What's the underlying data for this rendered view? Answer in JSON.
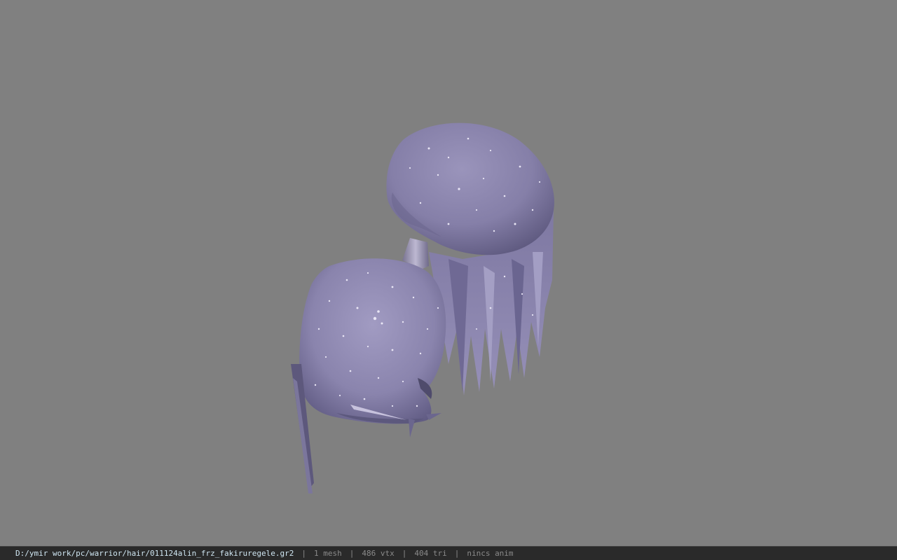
{
  "viewer": {
    "background_color": "#808080",
    "model": {
      "description_icon": "hair-mesh-model",
      "color": "#8e88ae"
    }
  },
  "status_bar": {
    "file_path": "D:/ymir work/pc/warrior/hair/011124alin_frz_fakiruregele.gr2",
    "separator": "|",
    "mesh_count": "1 mesh",
    "vertex_count": "486 vtx",
    "triangle_count": "404 tri",
    "anim_status": "nincs anim"
  }
}
